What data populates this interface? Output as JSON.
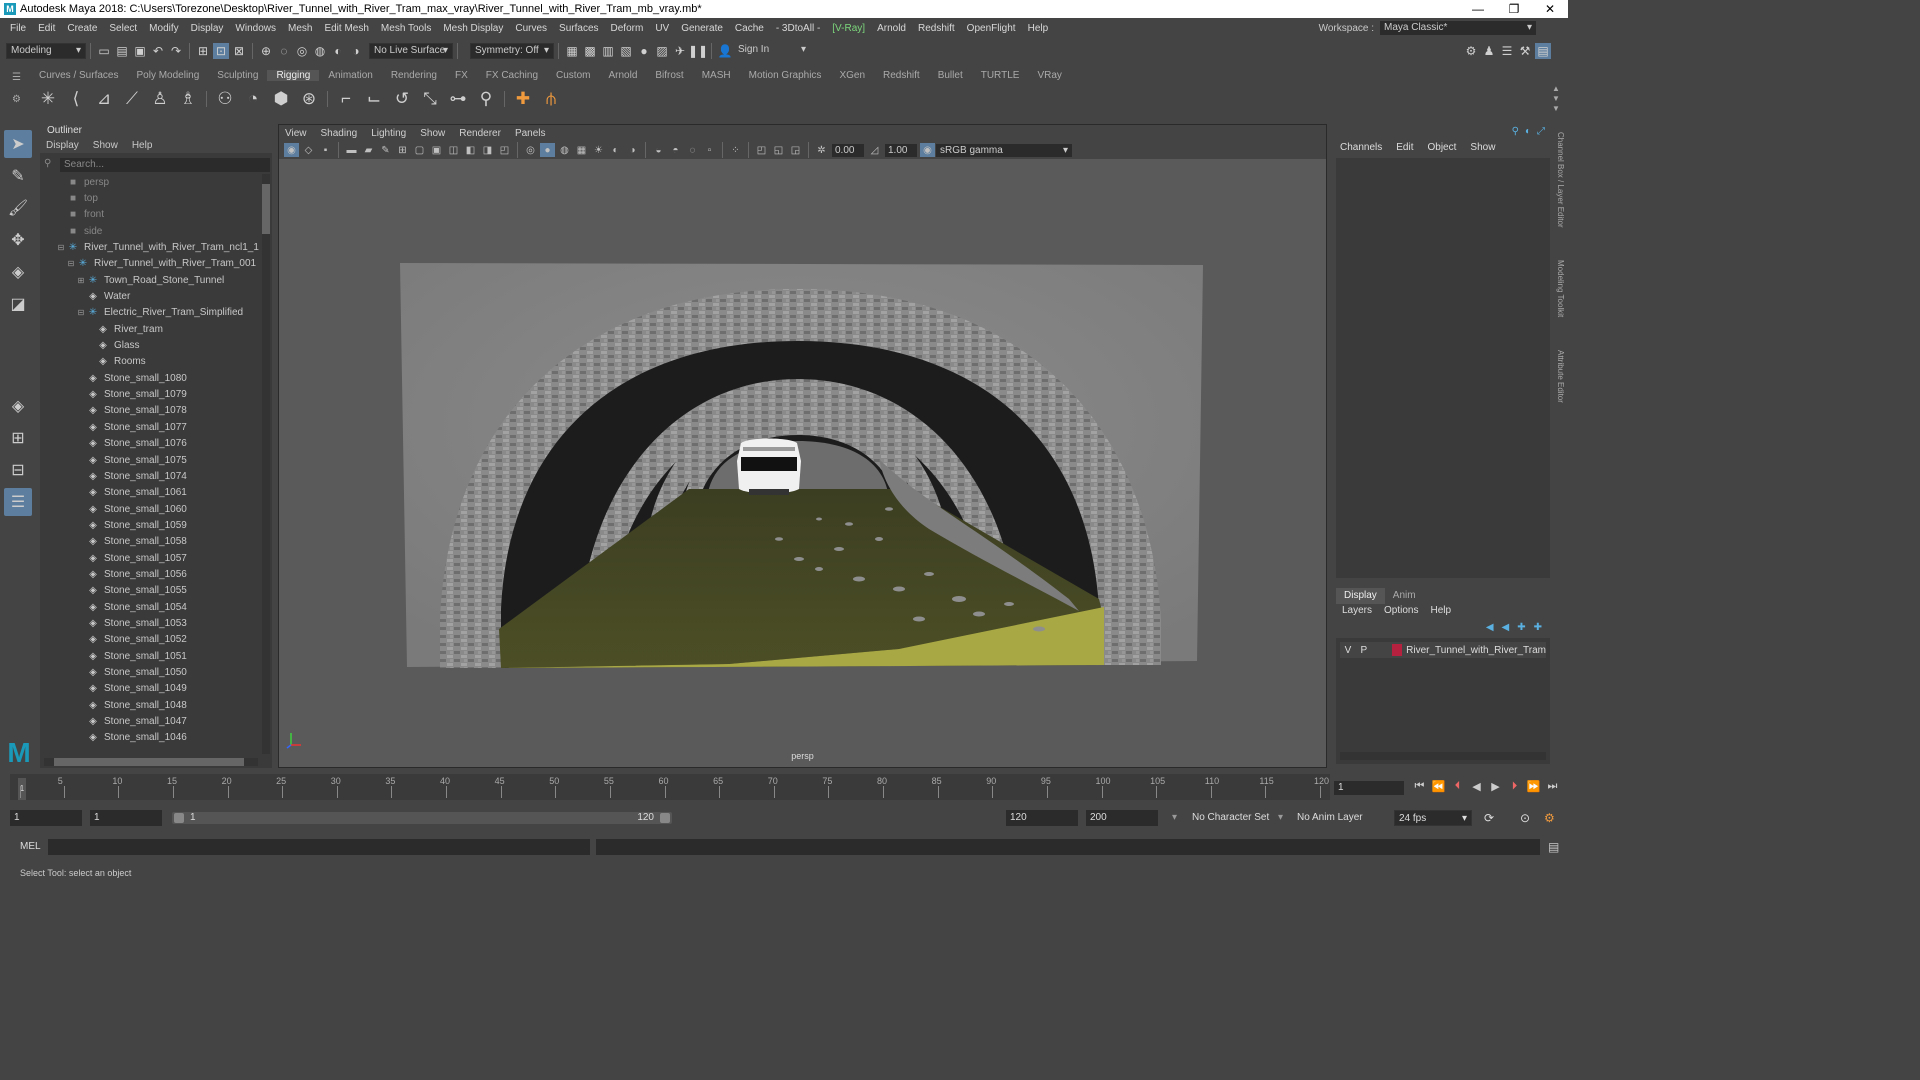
{
  "title": "Autodesk Maya 2018: C:\\Users\\Torezone\\Desktop\\River_Tunnel_with_River_Tram_max_vray\\River_Tunnel_with_River_Tram_mb_vray.mb*",
  "window_controls": {
    "minimize": "—",
    "restore": "❐",
    "close": "✕"
  },
  "menu": [
    "File",
    "Edit",
    "Create",
    "Select",
    "Modify",
    "Display",
    "Windows",
    "Mesh",
    "Edit Mesh",
    "Mesh Tools",
    "Mesh Display",
    "Curves",
    "Surfaces",
    "Deform",
    "UV",
    "Generate",
    "Cache",
    "- 3DtoAll -",
    "[V-Ray]",
    "Arnold",
    "Redshift",
    "OpenFlight",
    "Help"
  ],
  "workspace": {
    "label": "Workspace :",
    "value": "Maya Classic*"
  },
  "statusline": {
    "mode": "Modeling",
    "live_surface": "No Live Surface",
    "symmetry": "Symmetry: Off",
    "sign_in": "Sign In"
  },
  "shelf_tabs": [
    "Curves / Surfaces",
    "Poly Modeling",
    "Sculpting",
    "Rigging",
    "Animation",
    "Rendering",
    "FX",
    "FX Caching",
    "Custom",
    "Arnold",
    "Bifrost",
    "MASH",
    "Motion Graphics",
    "XGen",
    "Redshift",
    "Bullet",
    "TURTLE",
    "VRay"
  ],
  "shelf_active": "Rigging",
  "outliner": {
    "title": "Outliner",
    "menu": [
      "Display",
      "Show",
      "Help"
    ],
    "search_placeholder": "Search...",
    "items": [
      {
        "label": "persp",
        "type": "cam",
        "depth": 0,
        "exp": ""
      },
      {
        "label": "top",
        "type": "cam",
        "depth": 0,
        "exp": ""
      },
      {
        "label": "front",
        "type": "cam",
        "depth": 0,
        "exp": ""
      },
      {
        "label": "side",
        "type": "cam",
        "depth": 0,
        "exp": ""
      },
      {
        "label": "River_Tunnel_with_River_Tram_ncl1_1",
        "type": "grp",
        "depth": 0,
        "exp": "⊟"
      },
      {
        "label": "River_Tunnel_with_River_Tram_001",
        "type": "grp",
        "depth": 1,
        "exp": "⊟"
      },
      {
        "label": "Town_Road_Stone_Tunnel",
        "type": "grp",
        "depth": 2,
        "exp": "⊞"
      },
      {
        "label": "Water",
        "type": "mesh",
        "depth": 2,
        "exp": ""
      },
      {
        "label": "Electric_River_Tram_Simplified",
        "type": "grp",
        "depth": 2,
        "exp": "⊟"
      },
      {
        "label": "River_tram",
        "type": "mesh",
        "depth": 3,
        "exp": ""
      },
      {
        "label": "Glass",
        "type": "mesh",
        "depth": 3,
        "exp": ""
      },
      {
        "label": "Rooms",
        "type": "mesh",
        "depth": 3,
        "exp": ""
      },
      {
        "label": "Stone_small_1080",
        "type": "mesh",
        "depth": 2,
        "exp": ""
      },
      {
        "label": "Stone_small_1079",
        "type": "mesh",
        "depth": 2,
        "exp": ""
      },
      {
        "label": "Stone_small_1078",
        "type": "mesh",
        "depth": 2,
        "exp": ""
      },
      {
        "label": "Stone_small_1077",
        "type": "mesh",
        "depth": 2,
        "exp": ""
      },
      {
        "label": "Stone_small_1076",
        "type": "mesh",
        "depth": 2,
        "exp": ""
      },
      {
        "label": "Stone_small_1075",
        "type": "mesh",
        "depth": 2,
        "exp": ""
      },
      {
        "label": "Stone_small_1074",
        "type": "mesh",
        "depth": 2,
        "exp": ""
      },
      {
        "label": "Stone_small_1061",
        "type": "mesh",
        "depth": 2,
        "exp": ""
      },
      {
        "label": "Stone_small_1060",
        "type": "mesh",
        "depth": 2,
        "exp": ""
      },
      {
        "label": "Stone_small_1059",
        "type": "mesh",
        "depth": 2,
        "exp": ""
      },
      {
        "label": "Stone_small_1058",
        "type": "mesh",
        "depth": 2,
        "exp": ""
      },
      {
        "label": "Stone_small_1057",
        "type": "mesh",
        "depth": 2,
        "exp": ""
      },
      {
        "label": "Stone_small_1056",
        "type": "mesh",
        "depth": 2,
        "exp": ""
      },
      {
        "label": "Stone_small_1055",
        "type": "mesh",
        "depth": 2,
        "exp": ""
      },
      {
        "label": "Stone_small_1054",
        "type": "mesh",
        "depth": 2,
        "exp": ""
      },
      {
        "label": "Stone_small_1053",
        "type": "mesh",
        "depth": 2,
        "exp": ""
      },
      {
        "label": "Stone_small_1052",
        "type": "mesh",
        "depth": 2,
        "exp": ""
      },
      {
        "label": "Stone_small_1051",
        "type": "mesh",
        "depth": 2,
        "exp": ""
      },
      {
        "label": "Stone_small_1050",
        "type": "mesh",
        "depth": 2,
        "exp": ""
      },
      {
        "label": "Stone_small_1049",
        "type": "mesh",
        "depth": 2,
        "exp": ""
      },
      {
        "label": "Stone_small_1048",
        "type": "mesh",
        "depth": 2,
        "exp": ""
      },
      {
        "label": "Stone_small_1047",
        "type": "mesh",
        "depth": 2,
        "exp": ""
      },
      {
        "label": "Stone_small_1046",
        "type": "mesh",
        "depth": 2,
        "exp": ""
      }
    ]
  },
  "viewport": {
    "menu": [
      "View",
      "Shading",
      "Lighting",
      "Show",
      "Renderer",
      "Panels"
    ],
    "exposure": "0.00",
    "gamma": "1.00",
    "color_space": "sRGB gamma",
    "camera": "persp"
  },
  "channel_box": {
    "tabs": [
      "Channels",
      "Edit",
      "Object",
      "Show"
    ]
  },
  "layer_editor": {
    "tabs": [
      "Display",
      "Anim"
    ],
    "menu": [
      "Layers",
      "Options",
      "Help"
    ],
    "layer": {
      "v": "V",
      "p": "P",
      "name": "River_Tunnel_with_River_Tram",
      "color": "#b5213f"
    }
  },
  "side_tabs": [
    "Channel Box / Layer Editor",
    "Modeling Toolkit",
    "Attribute Editor"
  ],
  "timeline": {
    "labels": [
      "5",
      "10",
      "15",
      "20",
      "25",
      "30",
      "35",
      "40",
      "45",
      "50",
      "55",
      "60",
      "65",
      "70",
      "75",
      "80",
      "85",
      "90",
      "95",
      "100",
      "105",
      "110",
      "115",
      "120"
    ],
    "current": "1"
  },
  "current_frame": "1",
  "range": {
    "start": "1",
    "playback_start": "1",
    "slider_start": "1",
    "slider_end": "120",
    "playback_end": "120",
    "end": "200",
    "character_set": "No Character Set",
    "anim_layer": "No Anim Layer",
    "fps": "24 fps"
  },
  "mel_label": "MEL",
  "help_line": "Select Tool: select an object"
}
